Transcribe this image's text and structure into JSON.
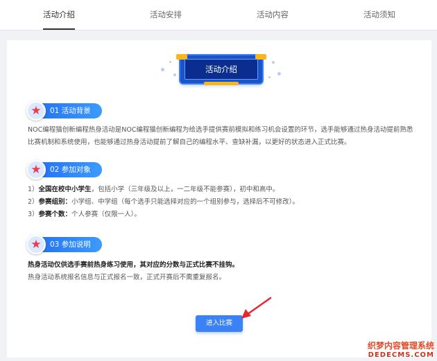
{
  "tabs": [
    {
      "label": "活动介绍",
      "active": true
    },
    {
      "label": "活动安排",
      "active": false
    },
    {
      "label": "活动内容",
      "active": false
    },
    {
      "label": "活动须知",
      "active": false
    }
  ],
  "banner": {
    "title": "活动介绍"
  },
  "sections": [
    {
      "label": "01 活动背景"
    },
    {
      "label": "02 参加对象"
    },
    {
      "label": "03 参加说明"
    }
  ],
  "background": {
    "text": "NOC编程猫创新编程热身活动是NOC编程猫创新编程为给选手提供赛前模拟和练习机会设置的环节，选手能够通过热身活动提前熟悉比赛机制和系统使用，也能够通过热身活动提前了解自己的编程水平、查缺补漏，以更好的状态进入正式比赛。"
  },
  "participants": [
    {
      "prefix": "1）",
      "bold": "全国在校中小学生",
      "rest": "，包括小学（三年级及以上，一二年级不能参赛），初中和高中。"
    },
    {
      "prefix": "2）",
      "bold": "参赛组别：",
      "rest": "小学组、中学组（每个选手只能选择对应的一个组别参与，选择后不可修改）。"
    },
    {
      "prefix": "3）",
      "bold": "参赛个数：",
      "rest": "个人参赛（仅限一人）。"
    }
  ],
  "notes": {
    "bold_line": "热身活动仅供选手赛前热身练习使用，其对应的分数与正式比赛不挂钩。",
    "line": "热身活动系统报名信息与正式报名一致，正式开赛后不需重复报名。"
  },
  "enter_button": {
    "label": "进入比赛"
  },
  "watermark": {
    "cn": "织梦内容管理系统",
    "en": "DEDECMS.COM"
  },
  "colors": {
    "accent": "#3b82f6",
    "pill": "#1f6df0",
    "star": "#ee3b4c",
    "arrow": "#e8262d",
    "banner_gold": "#f5b71b"
  }
}
